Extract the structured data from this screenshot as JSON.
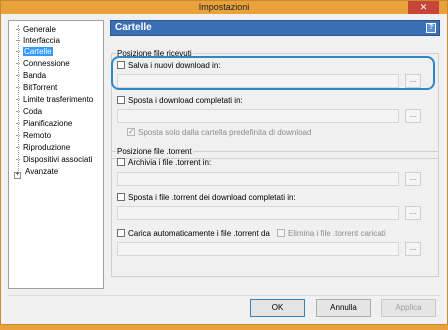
{
  "window": {
    "title": "Impostazioni",
    "close_glyph": "✕"
  },
  "sidebar": {
    "items": [
      {
        "label": "Generale"
      },
      {
        "label": "Interfaccia"
      },
      {
        "label": "Cartelle",
        "selected": true
      },
      {
        "label": "Connessione"
      },
      {
        "label": "Banda"
      },
      {
        "label": "BitTorrent"
      },
      {
        "label": "Limite trasferimento"
      },
      {
        "label": "Coda"
      },
      {
        "label": "Pianificazione"
      },
      {
        "label": "Remoto"
      },
      {
        "label": "Riproduzione"
      },
      {
        "label": "Dispositivi associati"
      },
      {
        "label": "Avanzate",
        "expandable": true
      }
    ],
    "expander_glyph": "+"
  },
  "panel": {
    "title": "Cartelle",
    "help_glyph": "?",
    "received": {
      "group_title": "Posizione file ricevuti",
      "save_new_label": "Salva i nuovi download in:",
      "save_new_checked": false,
      "move_completed_label": "Sposta i download completati in:",
      "move_completed_checked": false,
      "move_only_default_label": "Sposta solo dalla cartella predefinita di download",
      "move_only_default_checked": true
    },
    "torrent": {
      "group_title": "Posizione file .torrent",
      "archive_label": "Archivia i file .torrent in:",
      "archive_checked": false,
      "move_completed_torrent_label": "Sposta i file .torrent dei download completati in:",
      "move_completed_torrent_checked": false,
      "autoload_label": "Carica automaticamente i file .torrent da",
      "autoload_checked": false,
      "delete_loaded_label": "Elimina i file .torrent caricati",
      "delete_loaded_checked": false
    },
    "browse_label": "..."
  },
  "buttons": {
    "ok": "OK",
    "cancel": "Annulla",
    "apply": "Applica"
  },
  "colors": {
    "accent": "#3b6fb5",
    "highlight_ring": "#2f86c9",
    "title_bar": "#e9a23b"
  }
}
